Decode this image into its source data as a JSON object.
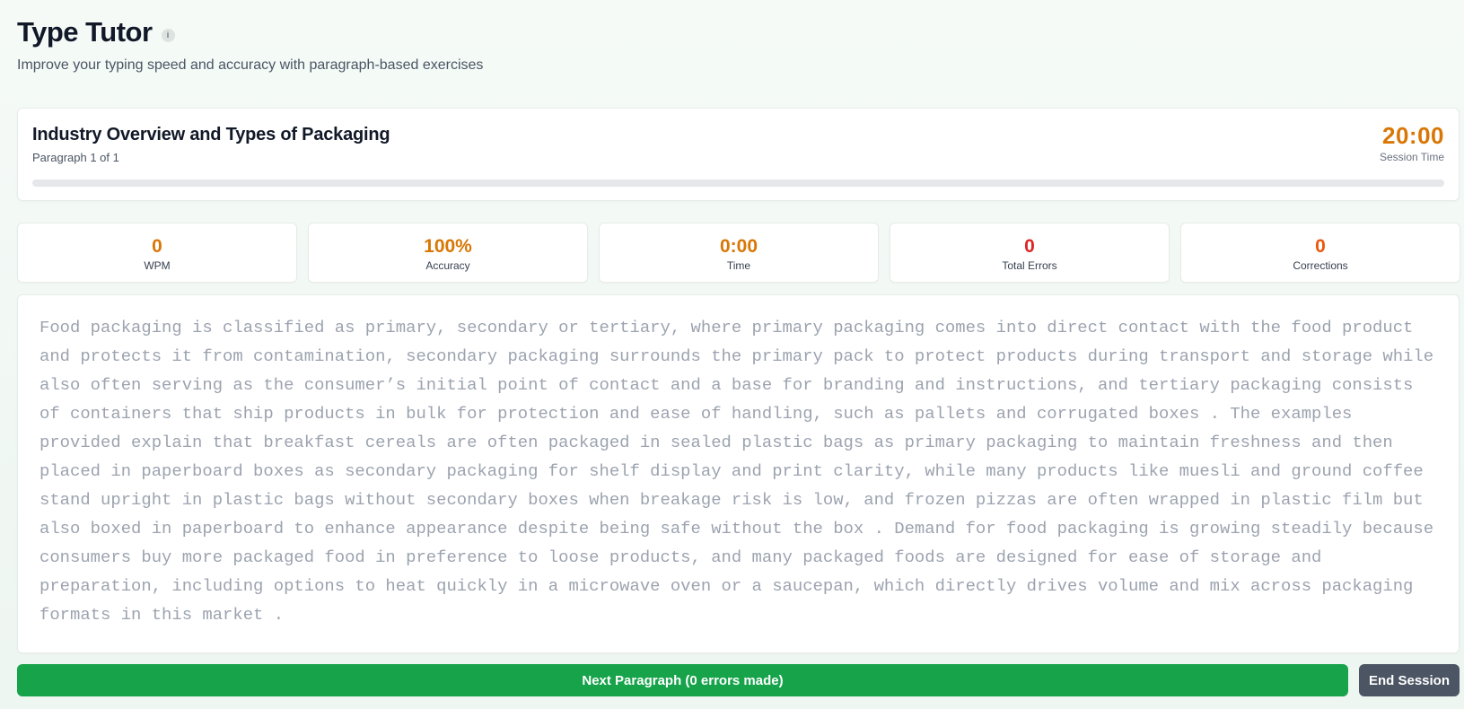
{
  "app": {
    "title": "Type Tutor",
    "info_icon": "i",
    "subtitle": "Improve your typing speed and accuracy with paragraph-based exercises"
  },
  "paragraph": {
    "title": "Industry Overview and Types of Packaging",
    "count": "Paragraph 1 of 1",
    "progress_percent": 0,
    "text": "Food packaging is classified as primary, secondary or tertiary, where primary packaging comes into direct contact with the food product and protects it from contamination, secondary packaging surrounds the primary pack to protect products during transport and storage while also often serving as the consumer’s initial point of contact and a base for branding and instructions, and tertiary packaging consists of containers that ship products in bulk for protection and ease of handling, such as pallets and corrugated boxes . The examples provided explain that breakfast cereals are often packaged in sealed plastic bags as primary packaging to maintain freshness and then placed in paperboard boxes as secondary packaging for shelf display and print clarity, while many products like muesli and ground coffee stand upright in plastic bags without secondary boxes when breakage risk is low, and frozen pizzas are often wrapped in plastic film but also boxed in paperboard to enhance appearance despite being safe without the box . Demand for food packaging is growing steadily because consumers buy more packaged food in preference to loose products, and many packaged foods are designed for ease of storage and preparation, including options to heat quickly in a microwave oven or a saucepan, which directly drives volume and mix across packaging formats in this market ."
  },
  "session": {
    "time": "20:00",
    "label": "Session Time"
  },
  "stats": [
    {
      "value": "0",
      "label": "WPM",
      "color": "#d97706"
    },
    {
      "value": "100%",
      "label": "Accuracy",
      "color": "#d97706"
    },
    {
      "value": "0:00",
      "label": "Time",
      "color": "#d97706"
    },
    {
      "value": "0",
      "label": "Total Errors",
      "color": "#dc2626"
    },
    {
      "value": "0",
      "label": "Corrections",
      "color": "#ea580c"
    }
  ],
  "actions": {
    "next_label": "Next Paragraph (0 errors made)",
    "end_label": "End Session"
  },
  "colors": {
    "accent_green": "#16a34a",
    "timer_amber": "#d97706",
    "end_gray": "#4b5563"
  }
}
